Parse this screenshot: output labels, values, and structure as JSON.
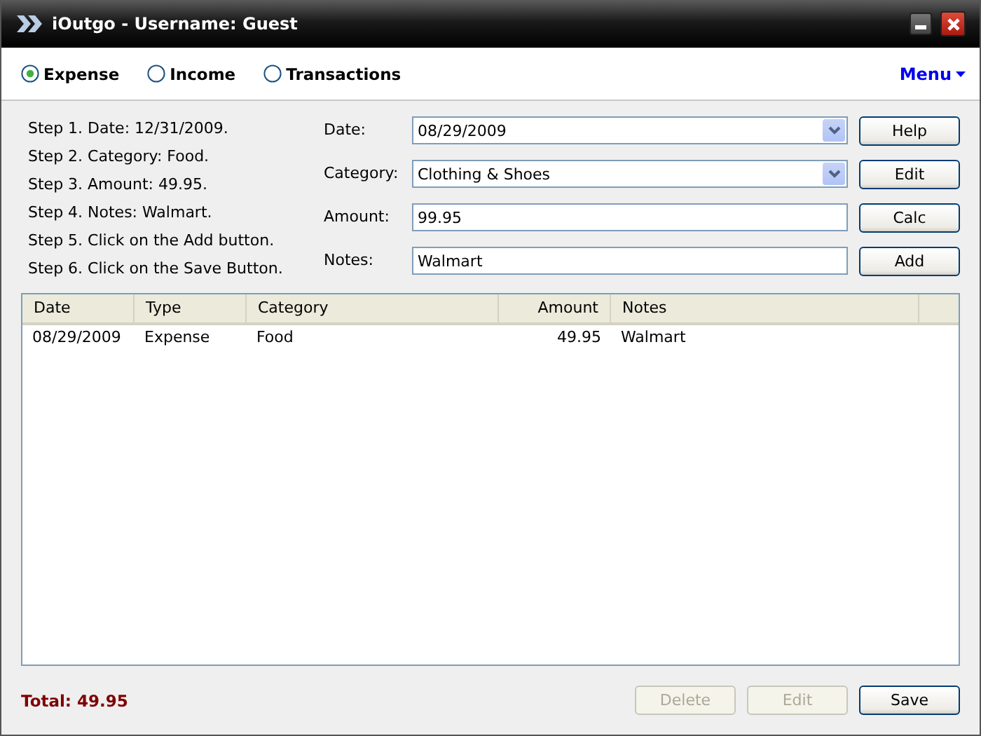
{
  "window": {
    "title": "iOutgo - Username: Guest"
  },
  "modes": [
    {
      "label": "Expense",
      "selected": true
    },
    {
      "label": "Income",
      "selected": false
    },
    {
      "label": "Transactions",
      "selected": false
    }
  ],
  "menu": {
    "label": "Menu"
  },
  "steps": [
    "Step 1. Date: 12/31/2009.",
    "Step 2. Category: Food.",
    "Step 3. Amount: 49.95.",
    "Step 4. Notes: Walmart.",
    "Step 5. Click on the Add button.",
    "Step 6. Click on the Save Button."
  ],
  "form": [
    {
      "label": "Date:",
      "kind": "dropdown",
      "value": "08/29/2009",
      "button": "Help"
    },
    {
      "label": "Category:",
      "kind": "dropdown",
      "value": "Clothing & Shoes",
      "button": "Edit"
    },
    {
      "label": "Amount:",
      "kind": "text",
      "value": "99.95",
      "button": "Calc"
    },
    {
      "label": "Notes:",
      "kind": "text",
      "value": "Walmart",
      "button": "Add"
    }
  ],
  "table": {
    "columns": [
      "Date",
      "Type",
      "Category",
      "Amount",
      "Notes"
    ],
    "rows": [
      [
        "08/29/2009",
        "Expense",
        "Food",
        "49.95",
        "Walmart"
      ]
    ]
  },
  "total": "Total: 49.95",
  "footer_buttons": [
    {
      "label": "Delete",
      "disabled": true
    },
    {
      "label": "Edit",
      "disabled": true
    },
    {
      "label": "Save",
      "disabled": false
    }
  ]
}
